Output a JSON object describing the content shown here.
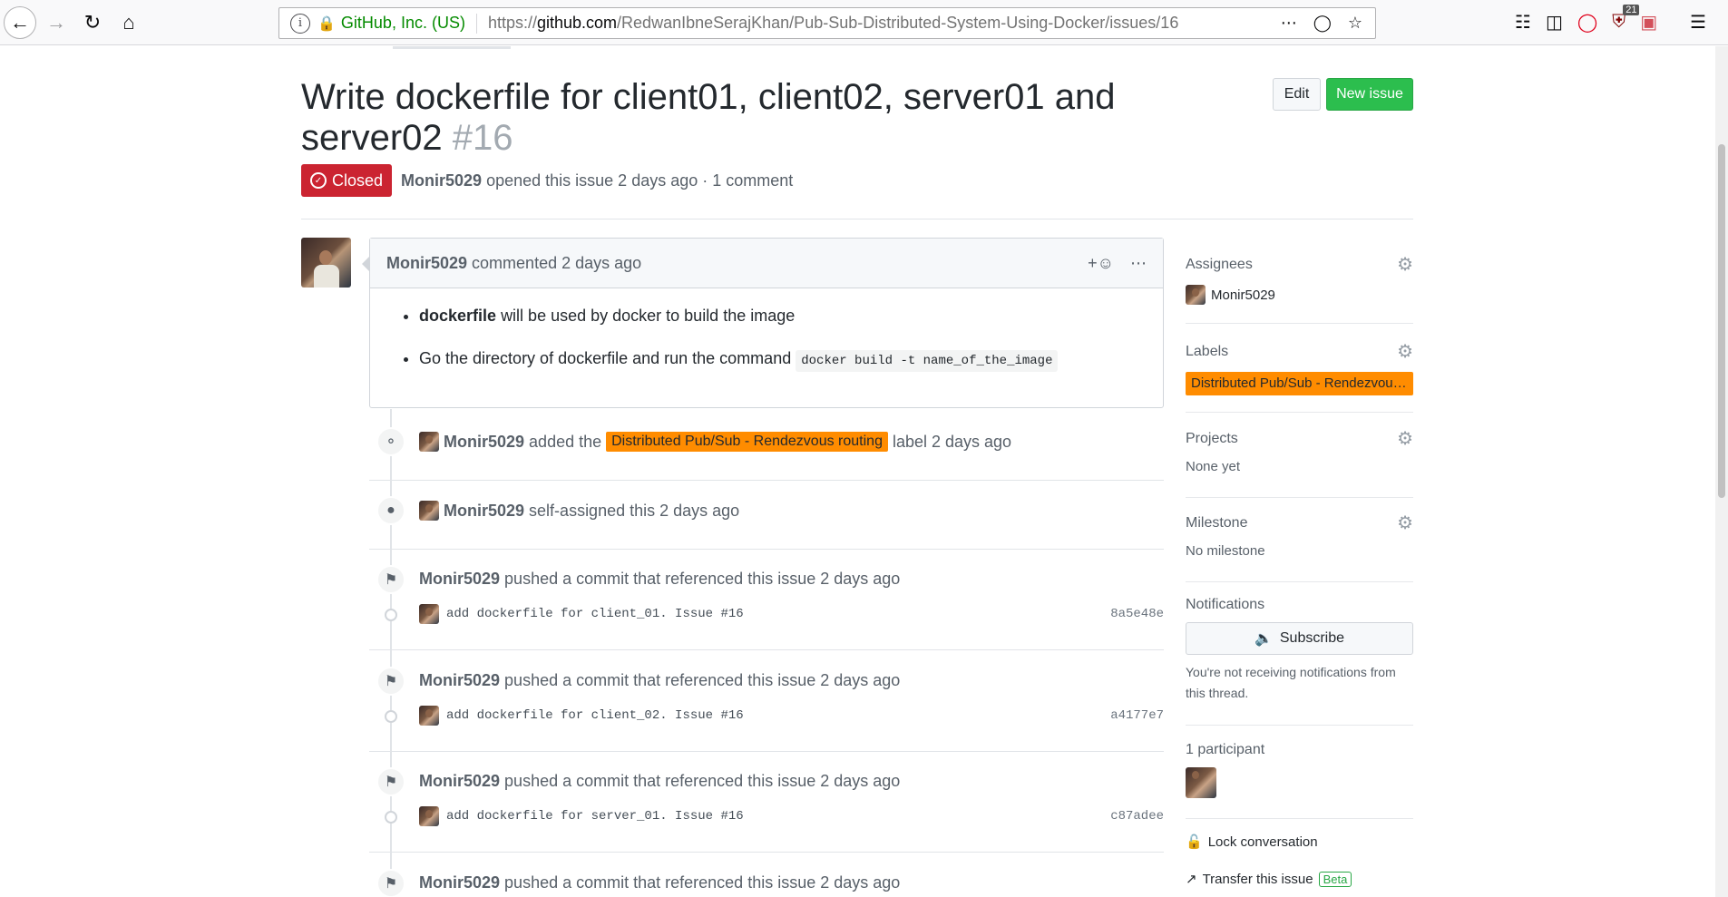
{
  "browser": {
    "identity": "GitHub, Inc. (US)",
    "url_prefix": "https://",
    "url_domain": "github.com",
    "url_path": "/RedwanIbneSerajKhan/Pub-Sub-Distributed-System-Using-Docker/issues/16",
    "badge_count": "21"
  },
  "issue": {
    "title": "Write dockerfile for client01, client02, server01 and server02",
    "number": "#16",
    "state": "Closed",
    "author": "Monir5029",
    "opened_text": "opened this issue 2 days ago · 1 comment"
  },
  "buttons": {
    "edit": "Edit",
    "new_issue": "New issue"
  },
  "comment": {
    "author": "Monir5029",
    "meta": "commented 2 days ago",
    "bullet1_bold": "dockerfile",
    "bullet1_rest": "will be used by docker to build the image",
    "bullet2_text": "Go the directory of dockerfile and run the command",
    "bullet2_code": "docker build -t name_of_the_image"
  },
  "events": {
    "label_event": {
      "author": "Monir5029",
      "pre": "added the",
      "label": "Distributed Pub/Sub - Rendezvous routing",
      "post": "label 2 days ago"
    },
    "assign_event": {
      "author": "Monir5029",
      "text": "self-assigned this 2 days ago"
    },
    "pushes": [
      {
        "author": "Monir5029",
        "text": "pushed a commit that referenced this issue 2 days ago",
        "commit": "add dockerfile for client_01. Issue #16",
        "sha": "8a5e48e"
      },
      {
        "author": "Monir5029",
        "text": "pushed a commit that referenced this issue 2 days ago",
        "commit": "add dockerfile for client_02. Issue #16",
        "sha": "a4177e7"
      },
      {
        "author": "Monir5029",
        "text": "pushed a commit that referenced this issue 2 days ago",
        "commit": "add dockerfile for server_01. Issue #16",
        "sha": "c87adee"
      },
      {
        "author": "Monir5029",
        "text": "pushed a commit that referenced this issue 2 days ago"
      }
    ]
  },
  "sidebar": {
    "assignees_h": "Assignees",
    "assignee": "Monir5029",
    "labels_h": "Labels",
    "label": "Distributed Pub/Sub - Rendezvous routing",
    "projects_h": "Projects",
    "projects_v": "None yet",
    "milestone_h": "Milestone",
    "milestone_v": "No milestone",
    "notifications_h": "Notifications",
    "subscribe": "Subscribe",
    "notif_note": "You're not receiving notifications from this thread.",
    "participants_h": "1 participant",
    "lock": "Lock conversation",
    "transfer": "Transfer this issue",
    "beta": "Beta"
  },
  "colors": {
    "closed": "#cb2431",
    "label": "#ff8c00",
    "new_issue": "#2cbe4e"
  }
}
